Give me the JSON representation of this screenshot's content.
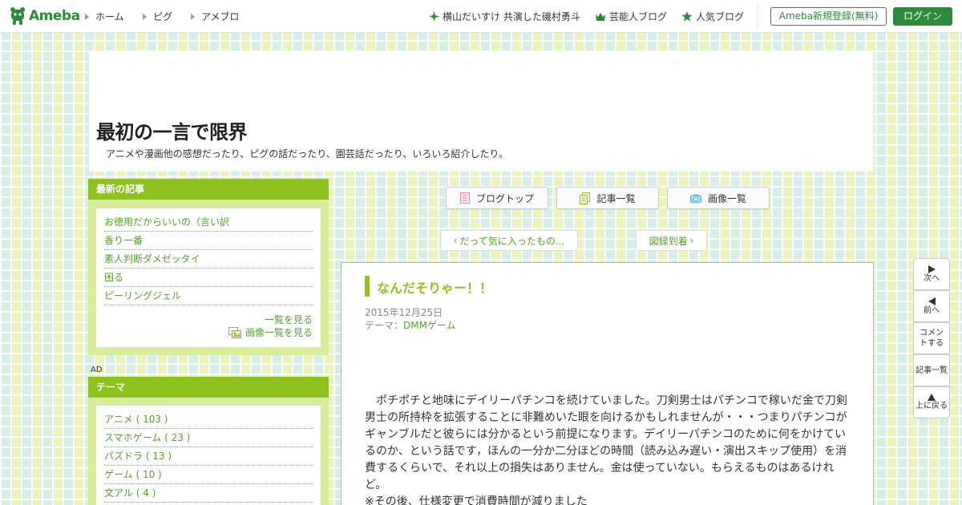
{
  "header": {
    "logo_text": "Ameba",
    "nav": [
      {
        "label": "ホーム"
      },
      {
        "label": "ピグ"
      },
      {
        "label": "アメブロ"
      }
    ],
    "right_links": [
      {
        "label": "横山だいすけ 共演した磯村勇斗",
        "icon": "sparkle-icon"
      },
      {
        "label": "芸能人ブログ",
        "icon": "crown-icon"
      },
      {
        "label": "人気ブログ",
        "icon": "star-icon"
      }
    ],
    "register_label": "Ameba新規登録(無料)",
    "login_label": "ログイン"
  },
  "blog": {
    "title": "最初の一言で限界",
    "description": "アニメや漫画他の感想だったり、ピグの話だったり、園芸話だったり、いろいろ紹介したり。"
  },
  "sidebar": {
    "latest": {
      "title": "最新の記事",
      "items": [
        {
          "label": "お徳用だからいいの（言い訳"
        },
        {
          "label": "香り一番"
        },
        {
          "label": "素人判断ダメゼッタイ"
        },
        {
          "label": "困る"
        },
        {
          "label": "ピーリングジェル"
        }
      ],
      "more_label": "一覧を見る",
      "images_label": "画像一覧を見る"
    },
    "ad_label": "AD",
    "themes": {
      "title": "テーマ",
      "items": [
        {
          "label": "アニメ ( 103 )"
        },
        {
          "label": "スマホゲーム ( 23 )"
        },
        {
          "label": "パズドラ ( 13 )"
        },
        {
          "label": "ゲーム ( 10 )"
        },
        {
          "label": "文アル ( 4 )"
        }
      ]
    }
  },
  "tabs": [
    {
      "label": "ブログトップ",
      "icon": "document-icon"
    },
    {
      "label": "記事一覧",
      "icon": "pages-icon"
    },
    {
      "label": "画像一覧",
      "icon": "camera-icon"
    }
  ],
  "pager": {
    "prev_label": "だって気に入ったもの...",
    "next_label": "図録到着"
  },
  "article": {
    "title": "なんだそりゃー！！",
    "date": "2015年12月25日",
    "theme_prefix": "テーマ：",
    "theme": "DMMゲーム",
    "body_lines": [
      "　ポチポチと地味にデイリーパチンコを続けていました。刀剣男士はパチンコで稼いだ金で刀剣男士の所持枠を拡張することに非難めいた眼を向けるかもしれませんが・・・つまりパチンコがギャンブルだと彼らには分かるという前提になります。デイリーパチンコのために何をかけているのか、という話です，ほんの一分か二分ほどの時間（読み込み遅い・演出スキップ使用）を消費するくらいで、それ以上の損失はありません。金は使っていない。もらえるものはあるけれど。",
      "※その後、仕様変更で消費時間が減りました"
    ]
  },
  "float_nav": [
    {
      "label": "次へ",
      "icon": "play-right-icon"
    },
    {
      "label": "前へ",
      "icon": "play-left-icon"
    },
    {
      "label": "コメントする",
      "icon": ""
    },
    {
      "label": "記事一覧",
      "icon": ""
    },
    {
      "label": "上に戻る",
      "icon": "triangle-up-icon"
    }
  ],
  "colors": {
    "brand": "#2d8c3c",
    "accent": "#8dc21f",
    "link": "#55a12c"
  }
}
